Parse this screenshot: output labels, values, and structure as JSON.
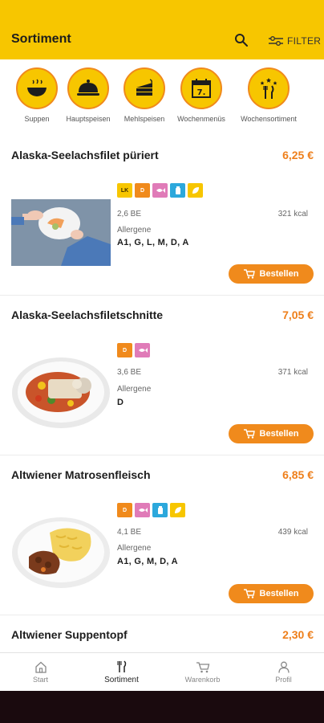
{
  "header": {
    "title": "Sortiment",
    "filter_label": "FILTER"
  },
  "categories": [
    {
      "label": "Suppen",
      "icon": "soup-bowl-icon"
    },
    {
      "label": "Hauptspeisen",
      "icon": "cloche-icon"
    },
    {
      "label": "Mehlspeisen",
      "icon": "cake-slice-icon"
    },
    {
      "label": "Wochenmenüs",
      "icon": "calendar-icon"
    },
    {
      "label": "Wochensortiment",
      "icon": "cutlery-stars-icon"
    }
  ],
  "items": [
    {
      "name": "Alaska-Seelachsfilet püriert",
      "price": "6,25 €",
      "badges": [
        "LK",
        "D",
        "fish",
        "salt",
        "leaf"
      ],
      "be": "2,6 BE",
      "kcal": "321 kcal",
      "allergen_label": "Allergene",
      "allergens": "A1, G, L, M, D, A",
      "order_label": "Bestellen"
    },
    {
      "name": "Alaska-Seelachsfiletschnitte",
      "price": "7,05 €",
      "badges": [
        "D",
        "fish"
      ],
      "be": "3,6 BE",
      "kcal": "371 kcal",
      "allergen_label": "Allergene",
      "allergens": "D",
      "order_label": "Bestellen"
    },
    {
      "name": "Altwiener Matrosenfleisch",
      "price": "6,85 €",
      "badges": [
        "D",
        "fish",
        "salt",
        "leaf"
      ],
      "be": "4,1 BE",
      "kcal": "439 kcal",
      "allergen_label": "Allergene",
      "allergens": "A1, G, M, D, A",
      "order_label": "Bestellen"
    },
    {
      "name": "Altwiener Suppentopf",
      "price": "2,30 €"
    }
  ],
  "tabbar": [
    {
      "label": "Start",
      "icon": "home-icon"
    },
    {
      "label": "Sortiment",
      "icon": "cutlery-icon"
    },
    {
      "label": "Warenkorb",
      "icon": "cart-icon"
    },
    {
      "label": "Profil",
      "icon": "person-icon"
    }
  ],
  "colors": {
    "brand_yellow": "#f7c600",
    "accent_orange": "#f08a1c",
    "badge_lk": "#f7c600",
    "badge_d": "#f08a1c",
    "badge_fish": "#e07bb8",
    "badge_salt": "#2ca8dc",
    "badge_leaf": "#f7c600"
  }
}
